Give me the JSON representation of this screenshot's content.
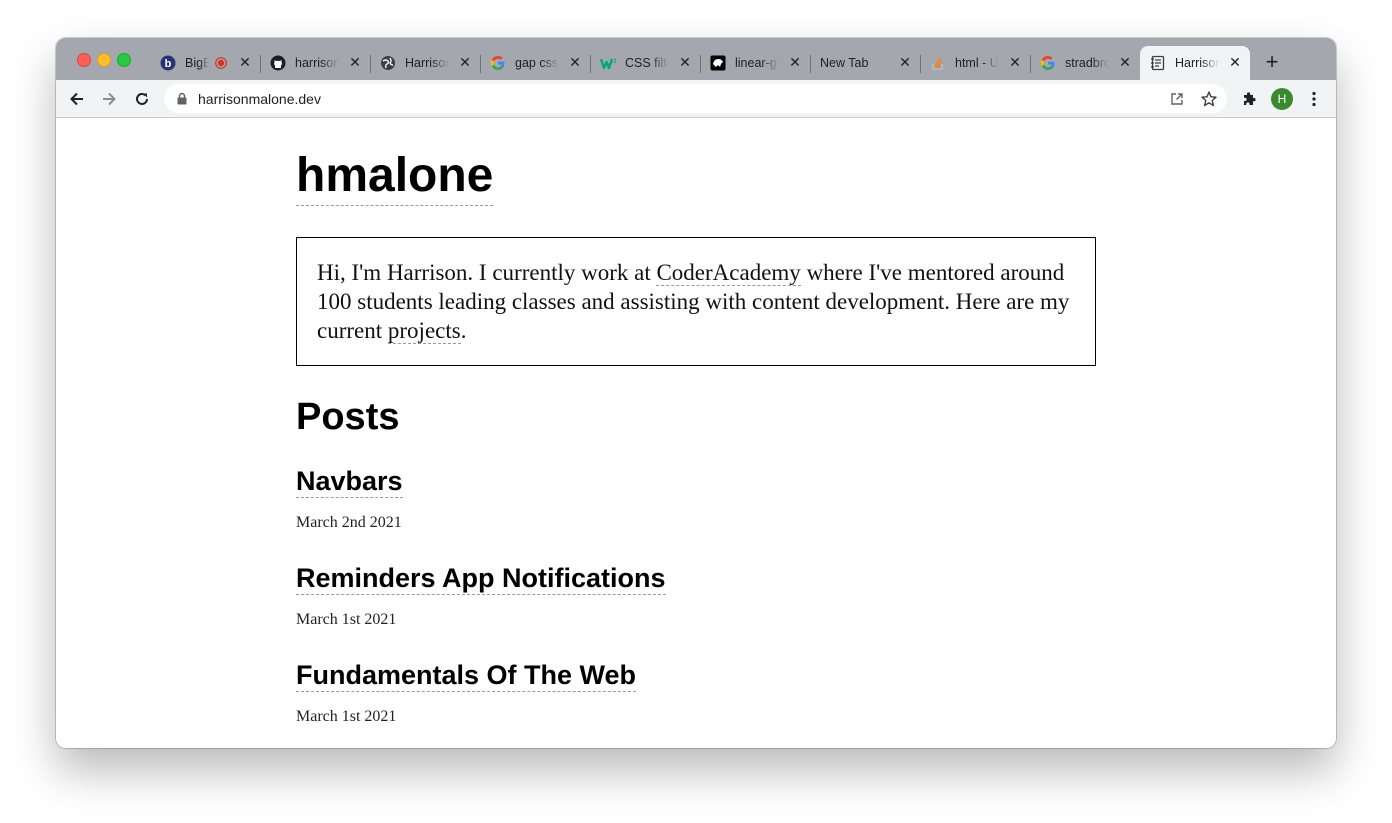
{
  "browser": {
    "tabs": [
      {
        "title": "BigBlueButton",
        "icon": "bigbluebutton-icon",
        "recording": true
      },
      {
        "title": "harrisonmalone",
        "icon": "github-icon"
      },
      {
        "title": "Harrison",
        "icon": "globe-icon"
      },
      {
        "title": "gap css",
        "icon": "google-icon"
      },
      {
        "title": "CSS filter",
        "icon": "w3schools-icon"
      },
      {
        "title": "linear-gradient",
        "icon": "mdn-icon"
      },
      {
        "title": "New Tab",
        "icon": ""
      },
      {
        "title": "html - U",
        "icon": "stackoverflow-icon"
      },
      {
        "title": "stradbroke",
        "icon": "google-icon"
      },
      {
        "title": "Harrison",
        "icon": "notebook-icon",
        "active": true
      }
    ],
    "url": "harrisonmalone.dev",
    "profile_initial": "H"
  },
  "page": {
    "site_title": "hmalone",
    "intro": {
      "text_1": "Hi, I'm Harrison. I currently work at ",
      "link_1": "CoderAcademy",
      "text_2": " where I've mentored around 100 students leading classes and assisting with content development. Here are my current ",
      "link_2": "projects",
      "text_3": "."
    },
    "posts_heading": "Posts",
    "posts": [
      {
        "title": "Navbars",
        "date": "March 2nd 2021"
      },
      {
        "title": "Reminders App Notifications",
        "date": "March 1st 2021"
      },
      {
        "title": "Fundamentals Of The Web",
        "date": "March 1st 2021"
      }
    ]
  },
  "colors": {
    "tabstrip": "#a4a7ad",
    "toolbar": "#f1f3f4",
    "avatar": "#3c8a2e"
  }
}
